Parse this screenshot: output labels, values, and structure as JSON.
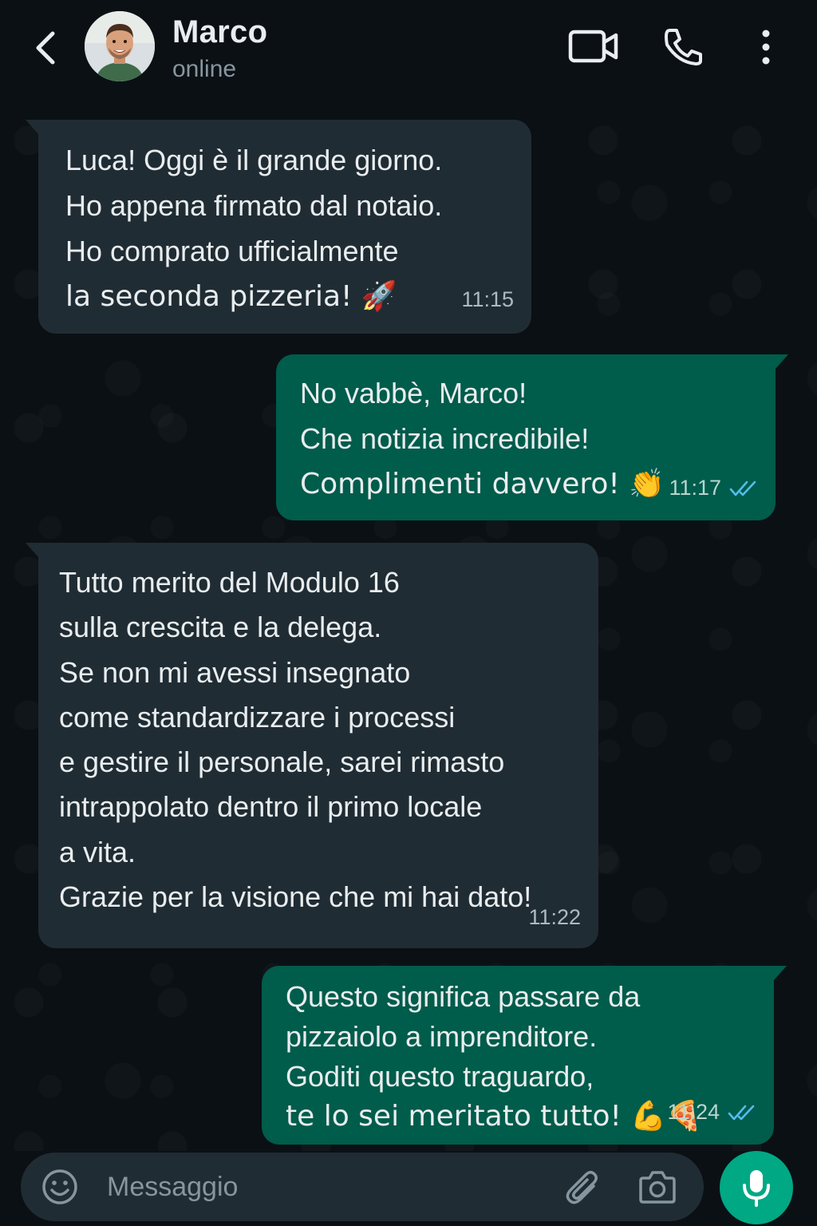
{
  "header": {
    "contact_name": "Marco",
    "status": "online",
    "icons": [
      "back-arrow-icon",
      "video-call-icon",
      "phone-call-icon",
      "more-options-icon"
    ]
  },
  "messages": [
    {
      "direction": "incoming",
      "lines": [
        "Luca! Oggi è il grande giorno.",
        "Ho appena firmato dal notaio.",
        "Ho comprato ufficialmente",
        "la seconda pizzeria! 🚀"
      ],
      "time": "11:15"
    },
    {
      "direction": "outgoing",
      "lines": [
        "No vabbè, Marco!",
        "Che notizia incredibile!",
        "Complimenti davvero! 👏"
      ],
      "time": "11:17",
      "status": "read"
    },
    {
      "direction": "incoming",
      "lines": [
        "Tutto merito del Modulo 16",
        "sulla crescita e la delega.",
        "Se non mi avessi insegnato",
        "come standardizzare i processi",
        "e gestire il personale, sarei rimasto",
        "intrappolato dentro il primo locale",
        "a vita.",
        "Grazie per la visione che mi hai dato!"
      ],
      "time": "11:22"
    },
    {
      "direction": "outgoing",
      "lines": [
        "Questo significa passare da",
        "pizzaiolo a imprenditore.",
        "Goditi questo traguardo,",
        "te lo sei meritato tutto! 💪🍕"
      ],
      "time": "11:24",
      "status": "read"
    }
  ],
  "composer": {
    "placeholder": "Messaggio",
    "icons": [
      "emoji-icon",
      "attach-icon",
      "camera-icon",
      "mic-icon"
    ]
  },
  "colors": {
    "background": "#0b1014",
    "incoming_bubble": "#202c33",
    "outgoing_bubble": "#005c4b",
    "accent": "#00a884",
    "read_ticks": "#53bdeb"
  }
}
